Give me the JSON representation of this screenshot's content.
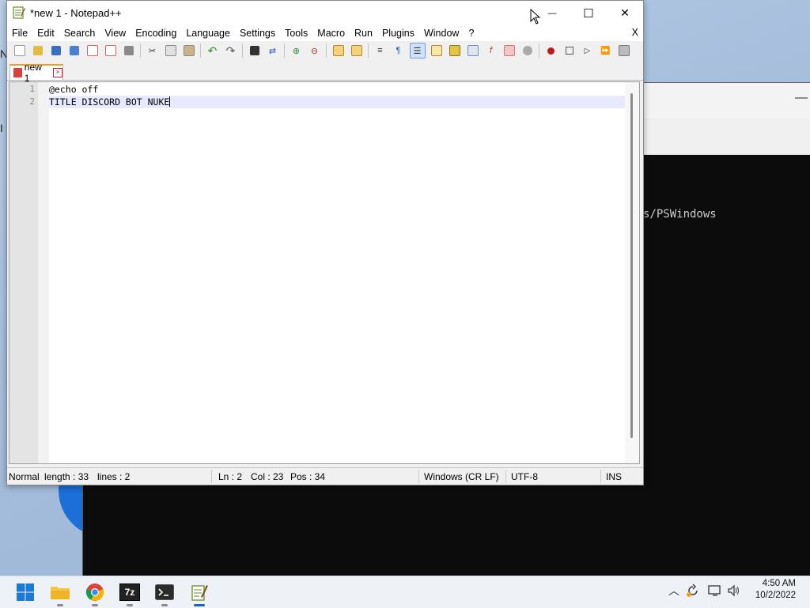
{
  "window": {
    "title": "*new 1 - Notepad++",
    "minimize_glyph": "—",
    "maximize_glyph": "☐",
    "close_glyph": "✕"
  },
  "menu": {
    "items": [
      "File",
      "Edit",
      "Search",
      "View",
      "Encoding",
      "Language",
      "Settings",
      "Tools",
      "Macro",
      "Run",
      "Plugins",
      "Window",
      "?"
    ],
    "close_doc": "X"
  },
  "tabs": [
    {
      "label": "new 1",
      "modified": true
    }
  ],
  "editor": {
    "lines": [
      {
        "number": "1",
        "text": "@echo off"
      },
      {
        "number": "2",
        "text": "TITLE DISCORD BOT NUKE"
      }
    ],
    "current_line": 2
  },
  "status": {
    "mode": "Normal",
    "length": "length : 33",
    "lines": "lines : 2",
    "ln": "Ln : 2",
    "col": "Col : 23",
    "pos": "Pos : 34",
    "eol": "Windows (CR LF)",
    "encoding": "UTF-8",
    "ins": "INS"
  },
  "background_terminal": {
    "visible_text": "s/PSWindows"
  },
  "taskbar": {
    "apps": [
      "start-icon",
      "file-explorer-icon",
      "chrome-icon",
      "7zip-icon",
      "terminal-icon",
      "notepadpp-icon"
    ],
    "seven_zip_label": "7z",
    "time": "4:50 AM",
    "date": "10/2/2022"
  },
  "colors": {
    "accent": "#1a62c4",
    "current_line": "#e8e8ff",
    "terminal_bg": "#0c0c0c"
  }
}
